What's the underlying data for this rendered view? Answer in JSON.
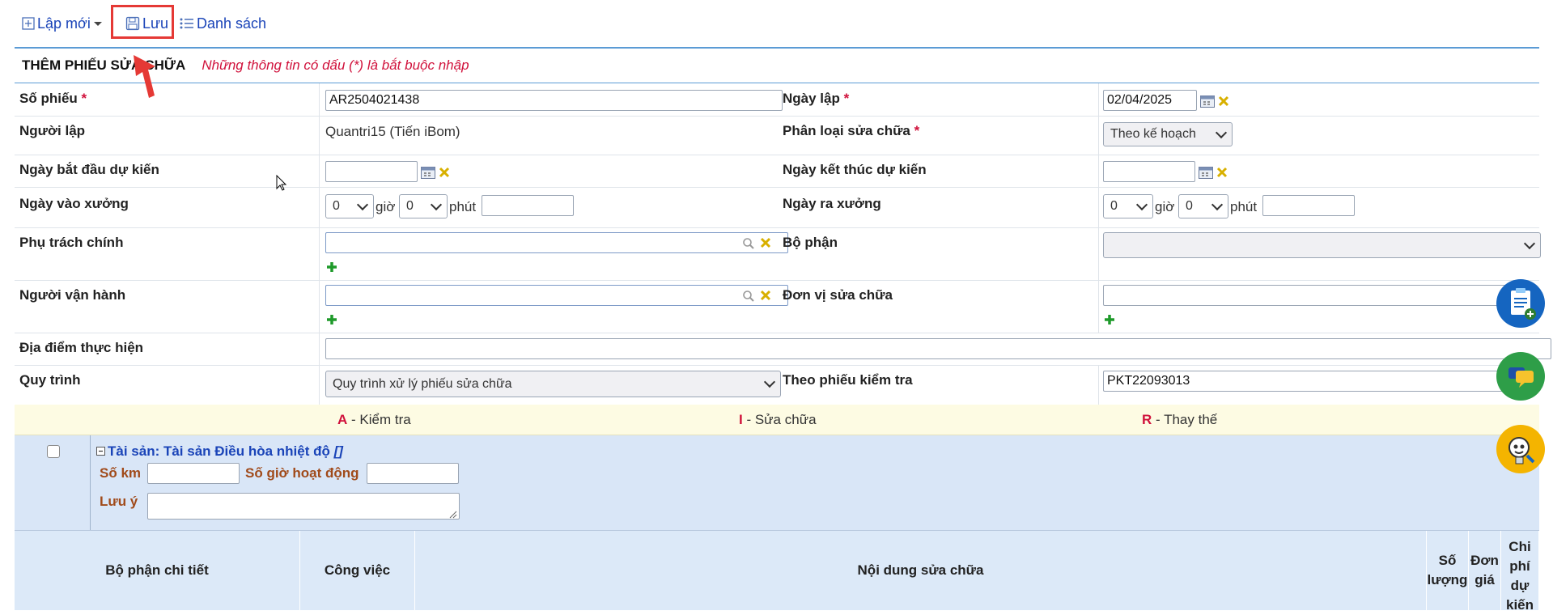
{
  "toolbar": {
    "new_label": "Lập mới",
    "save_label": "Lưu",
    "list_label": "Danh sách"
  },
  "form": {
    "title": "THÊM PHIẾU SỬA CHỮA",
    "note": "Những thông tin có dấu (*) là bắt buộc nhập",
    "required_mark": "*",
    "fields": {
      "so_phieu": {
        "label": "Số phiếu",
        "value": "AR2504021438"
      },
      "ngay_lap": {
        "label": "Ngày lập",
        "value": "02/04/2025"
      },
      "nguoi_lap": {
        "label": "Người lập",
        "value": "Quantri15 (Tiến iBom)"
      },
      "phan_loai": {
        "label": "Phân loại sửa chữa",
        "value": "Theo kế hoạch"
      },
      "ngay_bat_dau": {
        "label": "Ngày bắt đầu dự kiến",
        "value": ""
      },
      "ngay_ket_thuc": {
        "label": "Ngày kết thúc dự kiến",
        "value": ""
      },
      "ngay_vao_xuong": {
        "label": "Ngày vào xưởng",
        "hour": "0",
        "minute": "0",
        "hour_unit": "giờ",
        "minute_unit": "phút",
        "date": ""
      },
      "ngay_ra_xuong": {
        "label": "Ngày ra xưởng",
        "hour": "0",
        "minute": "0",
        "hour_unit": "giờ",
        "minute_unit": "phút",
        "date": ""
      },
      "phu_trach": {
        "label": "Phụ trách chính",
        "value": ""
      },
      "bo_phan": {
        "label": "Bộ phận",
        "value": ""
      },
      "nguoi_van_hanh": {
        "label": "Người vận hành",
        "value": ""
      },
      "don_vi": {
        "label": "Đơn vị sửa chữa",
        "value": ""
      },
      "dia_diem": {
        "label": "Địa điểm thực hiện",
        "value": ""
      },
      "quy_trinh": {
        "label": "Quy trình",
        "value": "Quy trình xử lý phiếu sửa chữa"
      },
      "theo_phieu_kt": {
        "label": "Theo phiếu kiểm tra",
        "value": "PKT22093013"
      }
    }
  },
  "legend": [
    {
      "key": "A",
      "text": " - Kiểm tra"
    },
    {
      "key": "I",
      "text": " - Sửa chữa"
    },
    {
      "key": "R",
      "text": " - Thay thế"
    }
  ],
  "asset": {
    "title": "Tài sản: Tài sản Điều hòa nhiệt độ",
    "title_suffix": "[]",
    "so_km_label": "Số km",
    "so_gio_label": "Số giờ hoạt động",
    "luu_y_label": "Lưu ý"
  },
  "table": {
    "headers": [
      "Bộ phận chi tiết",
      "Công việc",
      "Nội dung sửa chữa",
      "Số lượng",
      "Đơn giá",
      "Chi phí dự kiến"
    ]
  },
  "colors": {
    "link": "#1a44b8",
    "required": "#d0113b",
    "highlight": "#e53935",
    "accent_line": "#5b9bd5",
    "asset_bg": "#d9e6f7",
    "legend_bg": "#fdfbe3"
  }
}
